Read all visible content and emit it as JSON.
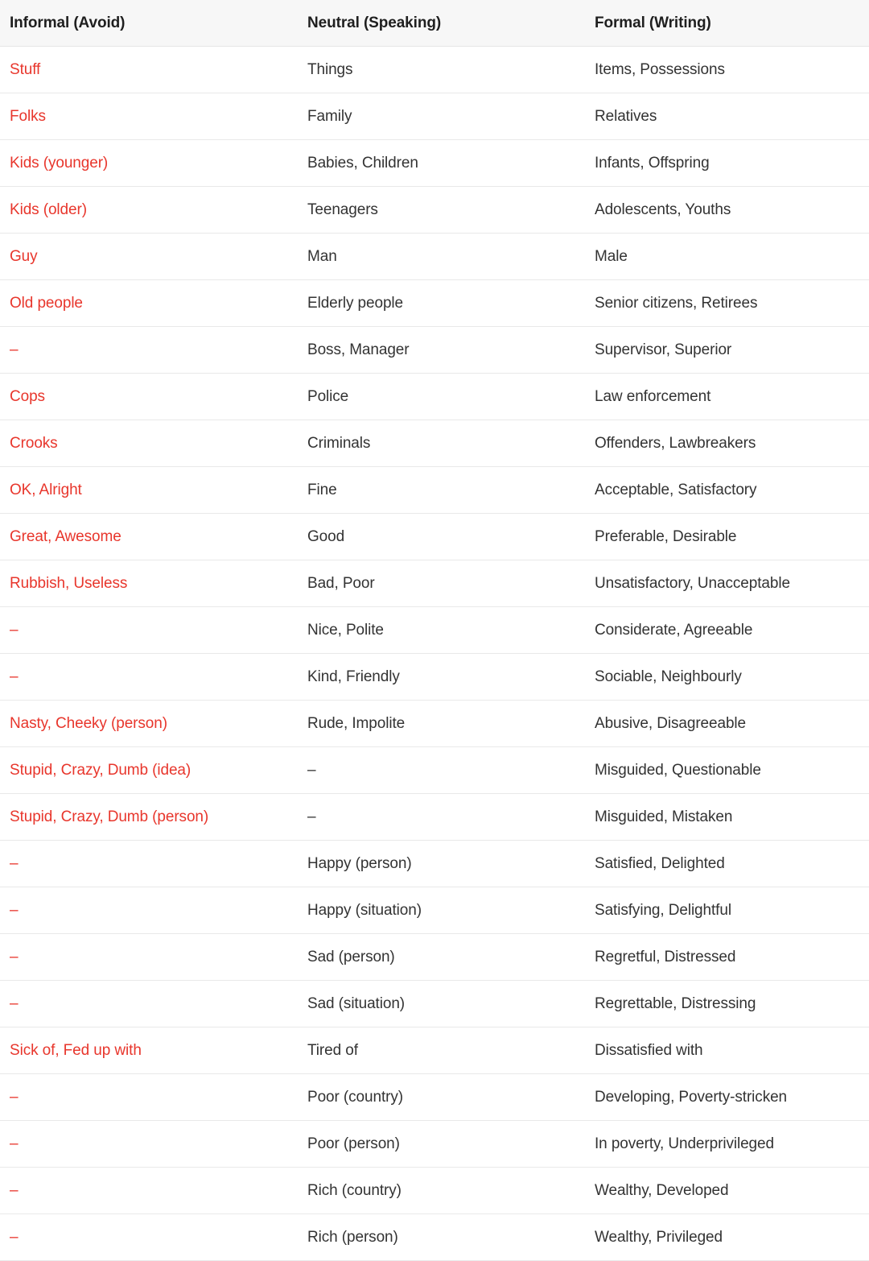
{
  "table": {
    "columns": [
      {
        "key": "informal",
        "label": "Informal (Avoid)"
      },
      {
        "key": "neutral",
        "label": "Neutral (Speaking)"
      },
      {
        "key": "formal",
        "label": "Formal (Writing)"
      }
    ],
    "colors": {
      "informal_text": "#e8362c",
      "body_text": "#333333",
      "header_text": "#1f1f1f",
      "header_background": "#f7f7f7",
      "row_border": "#e9e9e9",
      "page_background": "#ffffff"
    },
    "empty_marker": "–",
    "rows": [
      {
        "informal": "Stuff",
        "neutral": "Things",
        "formal": "Items, Possessions"
      },
      {
        "informal": "Folks",
        "neutral": "Family",
        "formal": "Relatives"
      },
      {
        "informal": "Kids (younger)",
        "neutral": "Babies, Children",
        "formal": "Infants, Offspring"
      },
      {
        "informal": "Kids (older)",
        "neutral": "Teenagers",
        "formal": "Adolescents, Youths"
      },
      {
        "informal": "Guy",
        "neutral": "Man",
        "formal": "Male"
      },
      {
        "informal": "Old people",
        "neutral": "Elderly people",
        "formal": "Senior citizens, Retirees"
      },
      {
        "informal": "–",
        "neutral": "Boss, Manager",
        "formal": "Supervisor, Superior"
      },
      {
        "informal": "Cops",
        "neutral": "Police",
        "formal": "Law enforcement"
      },
      {
        "informal": "Crooks",
        "neutral": "Criminals",
        "formal": "Offenders, Lawbreakers"
      },
      {
        "informal": "OK, Alright",
        "neutral": "Fine",
        "formal": "Acceptable, Satisfactory"
      },
      {
        "informal": "Great, Awesome",
        "neutral": "Good",
        "formal": "Preferable, Desirable"
      },
      {
        "informal": "Rubbish, Useless",
        "neutral": "Bad, Poor",
        "formal": "Unsatisfactory, Unacceptable"
      },
      {
        "informal": "–",
        "neutral": "Nice, Polite",
        "formal": "Considerate, Agreeable"
      },
      {
        "informal": "–",
        "neutral": "Kind, Friendly",
        "formal": "Sociable, Neighbourly"
      },
      {
        "informal": "Nasty, Cheeky (person)",
        "neutral": "Rude, Impolite",
        "formal": "Abusive, Disagreeable"
      },
      {
        "informal": "Stupid, Crazy, Dumb (idea)",
        "neutral": "–",
        "formal": "Misguided, Questionable"
      },
      {
        "informal": "Stupid, Crazy, Dumb (person)",
        "neutral": "–",
        "formal": "Misguided, Mistaken"
      },
      {
        "informal": "–",
        "neutral": "Happy (person)",
        "formal": "Satisfied, Delighted"
      },
      {
        "informal": "–",
        "neutral": "Happy (situation)",
        "formal": "Satisfying, Delightful"
      },
      {
        "informal": "–",
        "neutral": "Sad (person)",
        "formal": "Regretful, Distressed"
      },
      {
        "informal": "–",
        "neutral": "Sad (situation)",
        "formal": "Regrettable, Distressing"
      },
      {
        "informal": "Sick of, Fed up with",
        "neutral": "Tired of",
        "formal": "Dissatisfied with"
      },
      {
        "informal": "–",
        "neutral": "Poor (country)",
        "formal": "Developing, Poverty-stricken"
      },
      {
        "informal": "–",
        "neutral": "Poor (person)",
        "formal": "In poverty, Underprivileged"
      },
      {
        "informal": "–",
        "neutral": "Rich (country)",
        "formal": "Wealthy, Developed"
      },
      {
        "informal": "–",
        "neutral": "Rich (person)",
        "formal": "Wealthy, Privileged"
      }
    ]
  }
}
